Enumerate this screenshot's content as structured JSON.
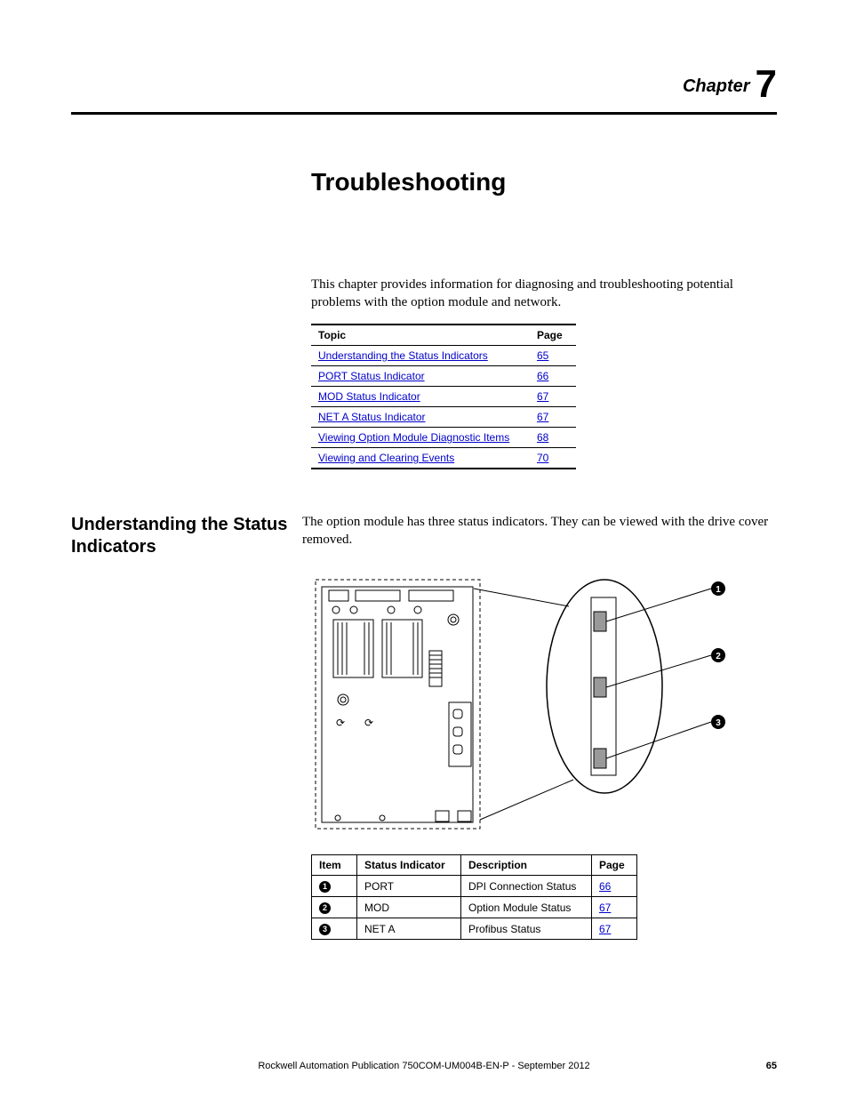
{
  "chapter": {
    "label": "Chapter",
    "number": "7"
  },
  "title": "Troubleshooting",
  "intro": "This chapter provides information for diagnosing and troubleshooting potential problems with the option module and network.",
  "topic_table": {
    "headers": {
      "topic": "Topic",
      "page": "Page"
    },
    "rows": [
      {
        "topic": "Understanding the Status Indicators",
        "page": "65"
      },
      {
        "topic": "PORT Status Indicator",
        "page": "66"
      },
      {
        "topic": "MOD Status Indicator",
        "page": "67"
      },
      {
        "topic": "NET A Status Indicator",
        "page": "67"
      },
      {
        "topic": "Viewing Option Module Diagnostic Items",
        "page": "68"
      },
      {
        "topic": "Viewing and Clearing Events",
        "page": "70"
      }
    ]
  },
  "section": {
    "heading": "Understanding the Status Indicators",
    "body": "The option module has three status indicators. They can be viewed with the drive cover removed."
  },
  "callouts": {
    "c1": "1",
    "c2": "2",
    "c3": "3"
  },
  "indicator_table": {
    "headers": {
      "item": "Item",
      "stat": "Status Indicator",
      "desc": "Description",
      "page": "Page"
    },
    "rows": [
      {
        "item_glyph": "1",
        "stat": "PORT",
        "desc": "DPI Connection Status",
        "page": "66"
      },
      {
        "item_glyph": "2",
        "stat": "MOD",
        "desc": "Option Module Status",
        "page": "67"
      },
      {
        "item_glyph": "3",
        "stat": "NET A",
        "desc": "Profibus Status",
        "page": "67"
      }
    ]
  },
  "footer": {
    "pub": "Rockwell Automation Publication 750COM-UM004B-EN-P - September 2012",
    "page_number": "65"
  }
}
